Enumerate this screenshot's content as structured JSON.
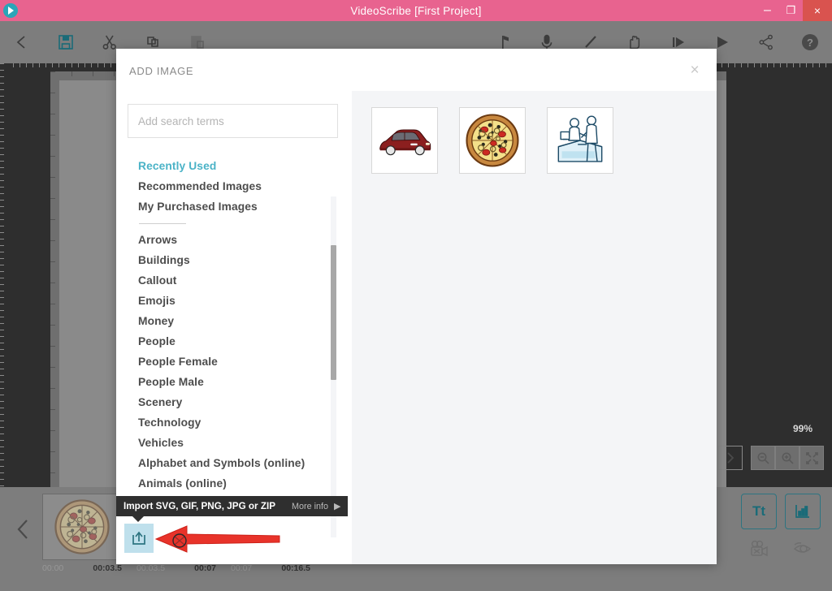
{
  "window": {
    "title": "VideoScribe [First Project]",
    "logo_icon": "videoscribe-play-logo",
    "minimize_label": "–",
    "maximize_label": "❐",
    "close_label": "×",
    "titlebar_color": "#e8638f",
    "close_color": "#d9534f"
  },
  "toolbar": {
    "left_items": [
      {
        "name": "back-button",
        "icon": "chevron-left-icon"
      },
      {
        "name": "save-button",
        "icon": "save-floppy-icon"
      },
      {
        "name": "cut-button",
        "icon": "scissors-icon"
      },
      {
        "name": "copy-button",
        "icon": "copy-icon"
      },
      {
        "name": "paste-button",
        "icon": "paste-icon"
      }
    ],
    "right_items": [
      {
        "name": "music-button",
        "icon": "music-note-icon"
      },
      {
        "name": "voiceover-button",
        "icon": "microphone-icon"
      },
      {
        "name": "hand-style-button",
        "icon": "pen-icon"
      },
      {
        "name": "hand-button",
        "icon": "hand-icon"
      },
      {
        "name": "play-from-start-button",
        "icon": "play-from-start-icon"
      },
      {
        "name": "play-button",
        "icon": "play-icon"
      },
      {
        "name": "share-button",
        "icon": "share-icon"
      },
      {
        "name": "help-button",
        "icon": "help-question-icon"
      }
    ]
  },
  "canvas": {
    "zoom_level": "99%",
    "controls": [
      {
        "name": "next-scene-button",
        "icon": "chevron-right-icon"
      },
      {
        "name": "zoom-out-button",
        "icon": "magnifier-minus-icon"
      },
      {
        "name": "zoom-in-button",
        "icon": "magnifier-plus-icon"
      },
      {
        "name": "fit-to-screen-button",
        "icon": "fit-arrows-icon"
      }
    ]
  },
  "modal": {
    "title": "ADD IMAGE",
    "close_label": "×",
    "search": {
      "placeholder": "Add search terms",
      "value": ""
    },
    "categories": [
      {
        "label": "Recently Used",
        "active": true
      },
      {
        "label": "Recommended Images",
        "active": false
      },
      {
        "label": "My Purchased Images",
        "active": false
      },
      {
        "label": "Arrows",
        "active": false
      },
      {
        "label": "Buildings",
        "active": false
      },
      {
        "label": "Callout",
        "active": false
      },
      {
        "label": "Emojis",
        "active": false
      },
      {
        "label": "Money",
        "active": false
      },
      {
        "label": "People",
        "active": false
      },
      {
        "label": "People Female",
        "active": false
      },
      {
        "label": "People Male",
        "active": false
      },
      {
        "label": "Scenery",
        "active": false
      },
      {
        "label": "Technology",
        "active": false
      },
      {
        "label": "Vehicles",
        "active": false
      },
      {
        "label": "Alphabet and Symbols (online)",
        "active": false
      },
      {
        "label": "Animals (online)",
        "active": false
      }
    ],
    "separator_after_index": 2,
    "results": [
      {
        "name": "image-result-car",
        "icon": "red-car-image",
        "alt": "red car"
      },
      {
        "name": "image-result-pizza",
        "icon": "pizza-image",
        "alt": "pizza"
      },
      {
        "name": "image-result-reception",
        "icon": "reception-desk-image",
        "alt": "two people at reception desk"
      }
    ],
    "active_category_color": "#4bb3c7"
  },
  "import": {
    "button_icon": "upload-import-icon",
    "tooltip_text": "Import SVG, GIF, PNG, JPG or ZIP",
    "more_info_label": "More info",
    "more_info_caret": "▶",
    "annotation_icon": "red-arrow-annotation",
    "accent_color": "#bfe0ec"
  },
  "timeline": {
    "prev_icon": "chevron-left-icon",
    "frames": [
      {
        "name": "timeline-frame-1",
        "thumb": "pizza-image",
        "start": "00:00",
        "end": "00:03.5",
        "selected": false
      },
      {
        "name": "timeline-frame-2",
        "thumb": "blank-image",
        "start": "00:03.5",
        "end": "00:07",
        "selected": false
      },
      {
        "name": "timeline-frame-3",
        "thumb": "reception-desk-image",
        "start": "00:07",
        "end": "00:16.5",
        "selected": true
      }
    ]
  },
  "bottom_right": {
    "row1": [
      {
        "name": "add-text-button",
        "label": "Tt",
        "icon": "text-tt-icon"
      },
      {
        "name": "add-chart-button",
        "label": "",
        "icon": "bar-chart-icon"
      }
    ],
    "row2": [
      {
        "name": "add-video-button",
        "icon": "video-camera-icon"
      },
      {
        "name": "preview-eye-button",
        "icon": "eye-icon"
      }
    ]
  }
}
